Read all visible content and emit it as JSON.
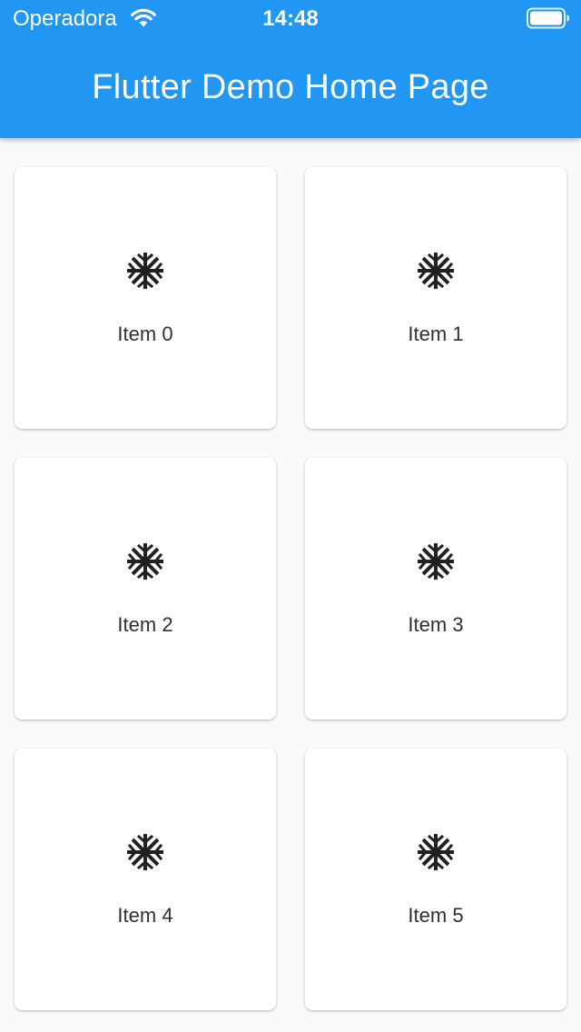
{
  "status_bar": {
    "carrier": "Operadora",
    "time": "14:48",
    "wifi_icon": "wifi-icon",
    "battery_icon": "battery-icon"
  },
  "app_bar": {
    "title": "Flutter Demo Home Page",
    "color": "#2196f3"
  },
  "grid": {
    "items": [
      {
        "label": "Item 0",
        "icon": "snowflake-icon"
      },
      {
        "label": "Item 1",
        "icon": "snowflake-icon"
      },
      {
        "label": "Item 2",
        "icon": "snowflake-icon"
      },
      {
        "label": "Item 3",
        "icon": "snowflake-icon"
      },
      {
        "label": "Item 4",
        "icon": "snowflake-icon"
      },
      {
        "label": "Item 5",
        "icon": "snowflake-icon"
      }
    ]
  }
}
